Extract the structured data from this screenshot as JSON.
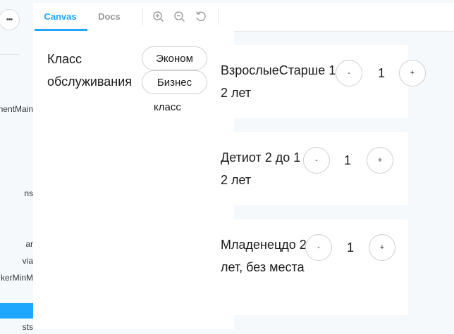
{
  "sidebar": {
    "more_label": "•••",
    "items": [
      "mentMain",
      "ns",
      "ar",
      "via",
      "kerMinM",
      "sts"
    ]
  },
  "toolbar": {
    "tabs": [
      "Canvas",
      "Docs"
    ],
    "icons": [
      "zoom-in-icon",
      "zoom-out-icon",
      "reset-zoom-icon"
    ]
  },
  "service_class": {
    "label": "Класс обслуживания",
    "options": [
      "Эконом",
      "Бизнес"
    ],
    "option_suffix": "класс"
  },
  "passengers": [
    {
      "title": "ВзрослыеСтарше 12 лет",
      "minus": "-",
      "count": "1",
      "plus": "+"
    },
    {
      "title": "Детиот 2 до 12 лет",
      "minus": "-",
      "count": "1",
      "plus": "+"
    },
    {
      "title": "Младенецдо 2 лет, без места",
      "minus": "-",
      "count": "1",
      "plus": "+"
    }
  ],
  "colors": {
    "accent": "#1ea7fd",
    "background": "#f6f9fc",
    "border": "#cfcfcf"
  }
}
